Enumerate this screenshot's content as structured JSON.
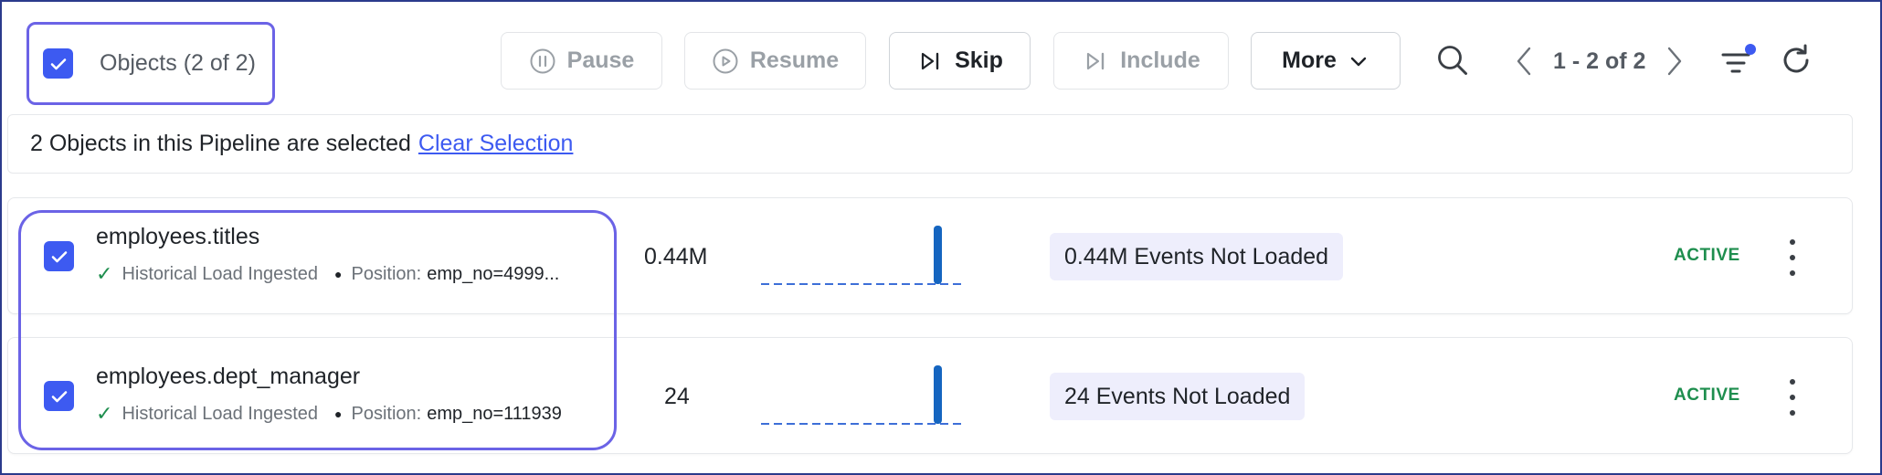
{
  "toolbar": {
    "select_all_label": "Objects (2 of 2)",
    "buttons": {
      "pause": {
        "label": "Pause",
        "icon": "pause-circle-icon"
      },
      "resume": {
        "label": "Resume",
        "icon": "play-circle-icon"
      },
      "skip": {
        "label": "Skip",
        "icon": "skip-icon"
      },
      "include": {
        "label": "Include",
        "icon": "skip-icon"
      },
      "more": {
        "label": "More",
        "icon": "chevron-down-icon"
      }
    },
    "pager_text": "1 - 2 of 2"
  },
  "banner": {
    "text": "2 Objects in this Pipeline are selected",
    "link": "Clear Selection"
  },
  "rows": [
    {
      "name": "employees.titles",
      "status_text": "Historical Load Ingested",
      "position_label": "Position:",
      "position_value": "emp_no=4999...",
      "count": "0.44M",
      "events_badge": "0.44M Events Not Loaded",
      "state": "ACTIVE"
    },
    {
      "name": "employees.dept_manager",
      "status_text": "Historical Load Ingested",
      "position_label": "Position:",
      "position_value": "emp_no=111939",
      "count": "24",
      "events_badge": "24 Events Not Loaded",
      "state": "ACTIVE"
    }
  ],
  "colors": {
    "accent": "#3d5af1",
    "outline": "#6b63e6",
    "active": "#1e8e4e",
    "badge_bg": "#eeeefc",
    "spark": "#1565c0"
  }
}
